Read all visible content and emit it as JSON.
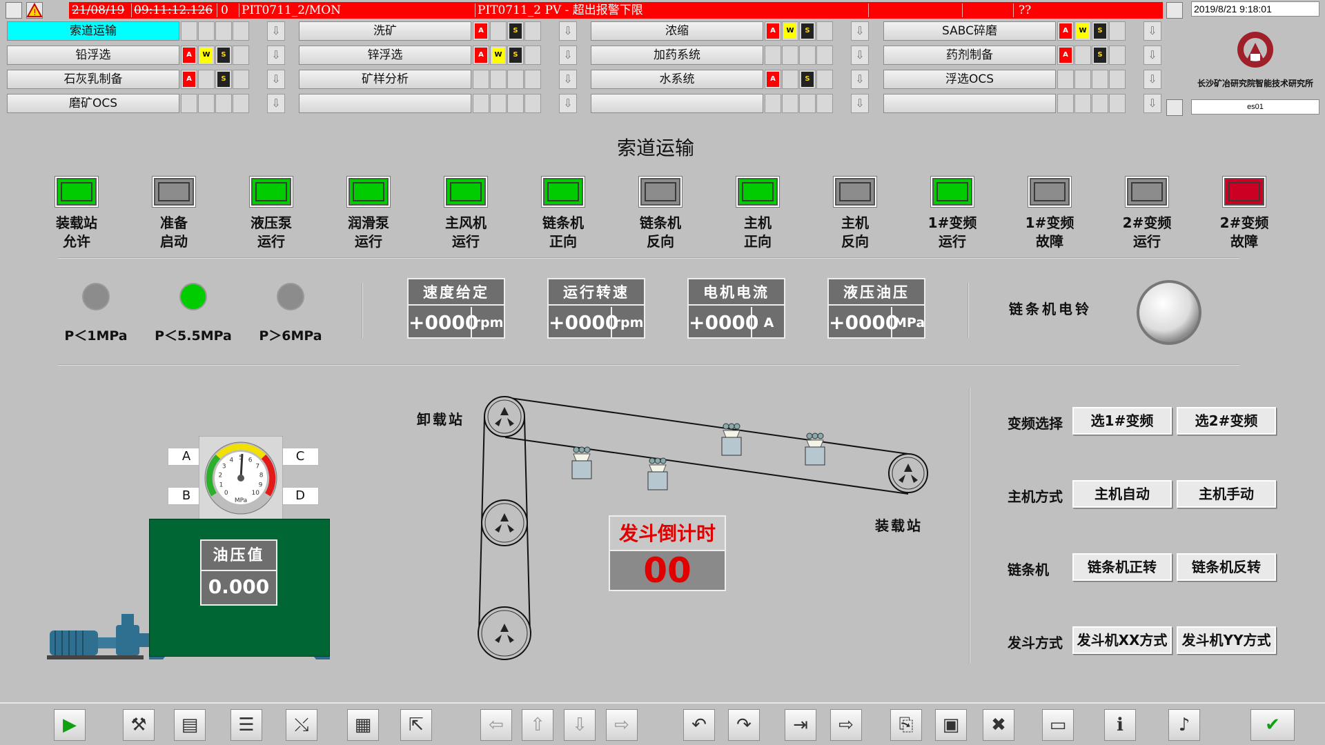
{
  "alarm": {
    "date": "21/08/19",
    "time": "09:11:12.126",
    "priority": "0",
    "tag": "PIT0711_2/MON",
    "message": "PIT0711_2 PV - 超出报警下限",
    "unknown": "??"
  },
  "clock": "2019/8/21 9:18:01",
  "station": "es01",
  "logo_text": "长沙矿冶研究院智能技术研究所",
  "nav": [
    [
      {
        "label": "索道运输",
        "tags": [
          "",
          "",
          "",
          ""
        ]
      },
      {
        "label": "洗矿",
        "tags": [
          "A",
          "",
          "S",
          ""
        ]
      },
      {
        "label": "浓缩",
        "tags": [
          "A",
          "W",
          "S",
          ""
        ]
      },
      {
        "label": "SABC碎磨",
        "tags": [
          "A",
          "W",
          "S",
          ""
        ]
      }
    ],
    [
      {
        "label": "铅浮选",
        "tags": [
          "A",
          "W",
          "S",
          ""
        ]
      },
      {
        "label": "锌浮选",
        "tags": [
          "A",
          "W",
          "S",
          ""
        ]
      },
      {
        "label": "加药系统",
        "tags": [
          "",
          "",
          "",
          ""
        ]
      },
      {
        "label": "药剂制备",
        "tags": [
          "A",
          "",
          "S",
          ""
        ]
      }
    ],
    [
      {
        "label": "石灰乳制备",
        "tags": [
          "A",
          "",
          "S",
          ""
        ]
      },
      {
        "label": "矿样分析",
        "tags": [
          "",
          "",
          "",
          ""
        ]
      },
      {
        "label": "水系统",
        "tags": [
          "A",
          "",
          "S",
          ""
        ]
      },
      {
        "label": "浮选OCS",
        "tags": [
          "",
          "",
          "",
          ""
        ]
      }
    ],
    [
      {
        "label": "磨矿OCS",
        "tags": [
          "",
          "",
          "",
          ""
        ]
      },
      {
        "label": "",
        "tags": [
          "",
          "",
          "",
          ""
        ]
      },
      {
        "label": "",
        "tags": [
          "",
          "",
          "",
          ""
        ]
      },
      {
        "label": "",
        "tags": [
          "",
          "",
          "",
          ""
        ]
      }
    ]
  ],
  "title": "索道运输",
  "indicators": [
    {
      "label": "装载站\n允许",
      "state": "green"
    },
    {
      "label": "准备\n启动",
      "state": "gray"
    },
    {
      "label": "液压泵\n运行",
      "state": "green"
    },
    {
      "label": "润滑泵\n运行",
      "state": "green"
    },
    {
      "label": "主风机\n运行",
      "state": "green"
    },
    {
      "label": "链条机\n正向",
      "state": "green"
    },
    {
      "label": "链条机\n反向",
      "state": "gray"
    },
    {
      "label": "主机\n正向",
      "state": "green"
    },
    {
      "label": "主机\n反向",
      "state": "gray"
    },
    {
      "label": "1#变频\n运行",
      "state": "green"
    },
    {
      "label": "1#变频\n故障",
      "state": "gray"
    },
    {
      "label": "2#变频\n运行",
      "state": "gray"
    },
    {
      "label": "2#变频\n故障",
      "state": "red"
    }
  ],
  "pressure_lamps": [
    {
      "label": "P＜1MPa",
      "state": "gray"
    },
    {
      "label": "P＜5.5MPa",
      "state": "green"
    },
    {
      "label": "P＞6MPa",
      "state": "gray"
    }
  ],
  "meters": [
    {
      "title": "速度给定",
      "value": "+0000",
      "unit": "rpm"
    },
    {
      "title": "运行转速",
      "value": "+0000",
      "unit": "rpm"
    },
    {
      "title": "电机电流",
      "value": "+0000",
      "unit": "A"
    },
    {
      "title": "液压油压",
      "value": "+0000",
      "unit": "MPa"
    }
  ],
  "bell_label": "链条机电铃",
  "conveyor": {
    "unload_label": "卸载站",
    "load_label": "装载站"
  },
  "countdown": {
    "title": "发斗倒计时",
    "value": "00"
  },
  "oil": {
    "title": "油压值",
    "value": "0.000",
    "ports": [
      "A",
      "B",
      "C",
      "D"
    ],
    "gauge_unit": "MPa",
    "gauge_scale": [
      "0",
      "1",
      "2",
      "3",
      "4",
      "5",
      "6",
      "7",
      "8",
      "9",
      "10"
    ]
  },
  "controls": [
    {
      "label": "变频选择",
      "buttons": [
        "选1#变频",
        "选2#变频"
      ]
    },
    {
      "label": "主机方式",
      "buttons": [
        "主机自动",
        "主机手动"
      ]
    },
    {
      "label": "链条机",
      "buttons": [
        "链条机正转",
        "链条机反转"
      ]
    },
    {
      "label": "发斗方式",
      "buttons": [
        "发斗机XX方式",
        "发斗机YY方式"
      ]
    }
  ],
  "toolbar": [
    "play-icon",
    "tools-icon",
    "notebook-icon",
    "report-icon",
    "trend-icon",
    "table-icon",
    "export-icon",
    "left-arrow-icon",
    "up-arrow-icon",
    "down-arrow-icon",
    "right-arrow-icon",
    "undo-icon",
    "redo-icon",
    "login-icon",
    "logout-icon",
    "open-icon",
    "save-icon",
    "close-doc-icon",
    "monitor-icon",
    "info-icon",
    "sound-icon",
    "ack-icon"
  ],
  "colors": {
    "green": "#00cc00",
    "gray": "#8c8c8c",
    "red": "#cc0022",
    "alarm": "#ff0000",
    "nav_active": "#00ffff",
    "tank": "#006633"
  }
}
